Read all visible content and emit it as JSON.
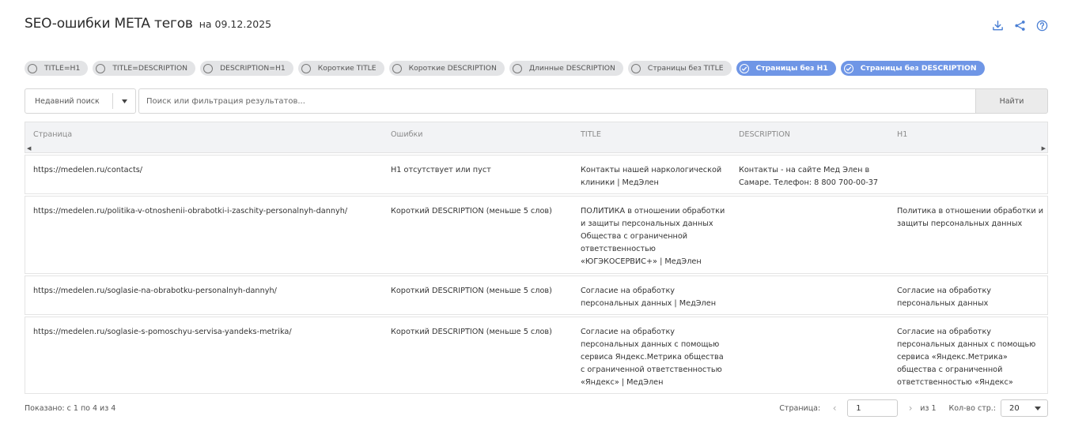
{
  "header": {
    "title": "SEO-ошибки META тегов",
    "subtitle": "на 09.12.2025",
    "icons": [
      "download-icon",
      "share-icon",
      "help-icon"
    ]
  },
  "filters": [
    {
      "label": "TITLE=H1",
      "active": false
    },
    {
      "label": "TITLE=DESCRIPTION",
      "active": false
    },
    {
      "label": "DESCRIPTION=H1",
      "active": false
    },
    {
      "label": "Короткие TITLE",
      "active": false
    },
    {
      "label": "Короткие DESCRIPTION",
      "active": false
    },
    {
      "label": "Длинные DESCRIPTION",
      "active": false
    },
    {
      "label": "Страницы без TITLE",
      "active": false
    },
    {
      "label": "Страницы без H1",
      "active": true
    },
    {
      "label": "Страницы без DESCRIPTION",
      "active": true
    }
  ],
  "search": {
    "recent_label": "Недавний поиск",
    "placeholder": "Поиск или фильтрация результатов...",
    "button": "Найти"
  },
  "table": {
    "columns": [
      "Страница",
      "Ошибки",
      "TITLE",
      "DESCRIPTION",
      "H1"
    ],
    "rows": [
      {
        "page": "https://medelen.ru/contacts/",
        "errors": "H1 отсутствует или пуст",
        "title": "Контакты нашей наркологической клиники | МедЭлен",
        "description": "Контакты - на сайте Мед Элен в Самаре. Телефон: 8 800 700-00-37",
        "h1": ""
      },
      {
        "page": "https://medelen.ru/politika-v-otnoshenii-obrabotki-i-zaschity-personalnyh-dannyh/",
        "errors": "Короткий DESCRIPTION (меньше 5 слов)",
        "title": "ПОЛИТИКА в отношении обработки и защиты персональных данных Общества с ограниченной ответственностью «ЮГЭКОСЕРВИС+» | МедЭлен",
        "description": "",
        "h1": "Политика в отношении обработки и защиты персональных данных"
      },
      {
        "page": "https://medelen.ru/soglasie-na-obrabotku-personalnyh-dannyh/",
        "errors": "Короткий DESCRIPTION (меньше 5 слов)",
        "title": "Согласие на обработку персональных данных | МедЭлен",
        "description": "",
        "h1": "Согласие на обработку персональных данных"
      },
      {
        "page": "https://medelen.ru/soglasie-s-pomoschyu-servisa-yandeks-metrika/",
        "errors": "Короткий DESCRIPTION (меньше 5 слов)",
        "title": "Согласие на обработку персональных данных с помощью сервиса Яндекс.Метрика общества с ограниченной ответственностью «Яндекс» | МедЭлен",
        "description": "",
        "h1": "Согласие на обработку персональных данных с помощью сервиса «Яндекс.Метрика» общества с ограниченной ответственностью «Яндекс»"
      }
    ]
  },
  "footer": {
    "shown": "Показано: с 1 по 4 из 4",
    "page_label": "Страница:",
    "page_value": "1",
    "of_pages": "из 1",
    "page_size_label": "Кол-во стр.:",
    "page_size": "20"
  },
  "colors": {
    "chip_active": "#6f96e6",
    "chip_inactive": "#e3e4e6",
    "header_icon": "#4a7fd4"
  }
}
